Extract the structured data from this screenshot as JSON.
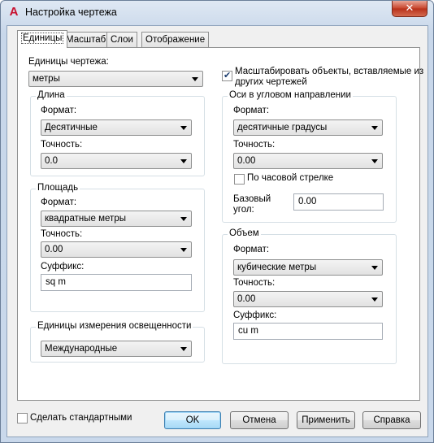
{
  "window": {
    "title": "Настройка чертежа",
    "close_glyph": "✕",
    "app_icon": "A"
  },
  "tabs": [
    "Единицы",
    "Масштаб",
    "Слои",
    "Отображение"
  ],
  "drawing_units": {
    "label": "Единицы чертежа:",
    "value": "метры"
  },
  "scale_inserted": {
    "label_line1": "Масштабировать объекты, вставляемые из",
    "label_line2": "других чертежей",
    "checked": true
  },
  "length": {
    "title": "Длина",
    "format_label": "Формат:",
    "format_value": "Десятичные",
    "precision_label": "Точность:",
    "precision_value": "0.0"
  },
  "area": {
    "title": "Площадь",
    "format_label": "Формат:",
    "format_value": "квадратные метры",
    "precision_label": "Точность:",
    "precision_value": "0.00",
    "suffix_label": "Суффикс:",
    "suffix_value": "sq m"
  },
  "lighting": {
    "title": "Единицы измерения освещенности",
    "value": "Международные"
  },
  "angles": {
    "title": "Оси в угловом направлении",
    "format_label": "Формат:",
    "format_value": "десятичные градусы",
    "precision_label": "Точность:",
    "precision_value": "0.00",
    "clockwise_label": "По часовой стрелке",
    "clockwise_checked": false,
    "base_angle_label_1": "Базовый",
    "base_angle_label_2": "угол:",
    "base_angle_value": "0.00"
  },
  "volume": {
    "title": "Объем",
    "format_label": "Формат:",
    "format_value": "кубические метры",
    "precision_label": "Точность:",
    "precision_value": "0.00",
    "suffix_label": "Суффикс:",
    "suffix_value": "cu m"
  },
  "footer": {
    "make_default_label": "Сделать стандартными",
    "make_default_checked": false,
    "ok": "OK",
    "cancel": "Отмена",
    "apply": "Применить",
    "help": "Справка"
  }
}
